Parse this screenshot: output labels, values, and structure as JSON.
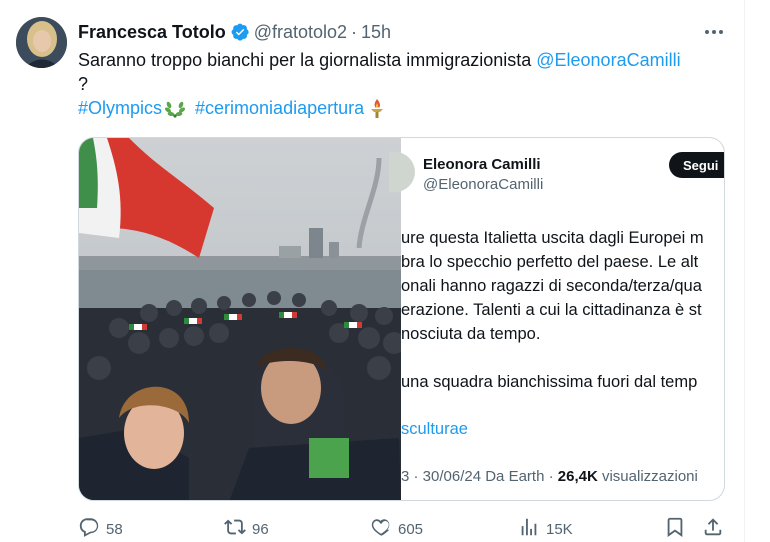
{
  "tweet": {
    "display_name": "Francesca Totolo",
    "handle": "@fratotolo2",
    "separator": "·",
    "time": "15h",
    "text_line1_prefix": "Saranno troppo bianchi per la giornalista immigrazionista ",
    "text_line1_mention": "@EleonoraCamilli",
    "text_line2": "?",
    "hashtag1": "#Olympics",
    "hashtag2": "#cerimoniadiapertura"
  },
  "quote": {
    "name": "Eleonora Camilli",
    "handle": "@EleonoraCamilli",
    "follow_label": "Segui",
    "lines": [
      "ure questa Italietta uscita dagli Europei m",
      "bra lo specchio perfetto del paese. Le alt",
      "onali hanno ragazzi di seconda/terza/qua",
      "erazione. Talenti a cui la cittadinanza è st",
      "nosciuta da tempo."
    ],
    "line6": "una squadra bianchissima fuori dal temp",
    "link": "sculturae",
    "meta_prefix": "3 · 30/06/24 Da Earth · ",
    "meta_views": "26,4K",
    "meta_suffix": " visualizzazioni"
  },
  "actions": {
    "replies": "58",
    "reposts": "96",
    "likes": "605",
    "views": "15K"
  },
  "colors": {
    "accent": "#1d9bf0",
    "text": "#0f1419",
    "secondary": "#536471",
    "border": "#cfd9de"
  },
  "icons": [
    "verified-badge-icon",
    "more-icon",
    "laurel-emoji-icon",
    "torch-emoji-icon",
    "reply-icon",
    "repost-icon",
    "like-icon",
    "views-icon",
    "bookmark-icon",
    "share-icon"
  ]
}
